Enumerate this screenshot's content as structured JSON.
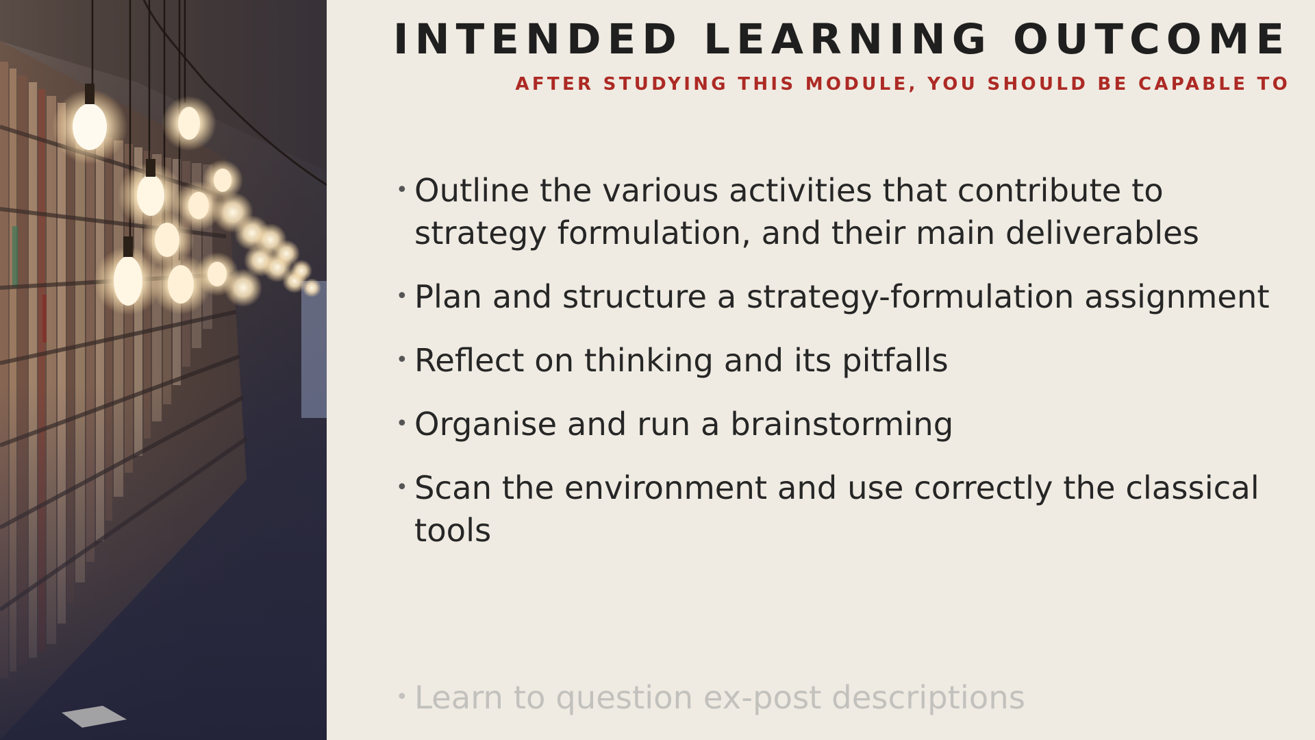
{
  "title": "INTENDED LEARNING OUTCOME",
  "subtitle": "AFTER STUDYING THIS MODULE, YOU SHOULD BE CAPABLE TO",
  "bullet_glyph": "•",
  "outcomes": [
    "Outline the various activities that contribute to strategy formulation, and their main deliverables",
    "Plan and structure a strategy-formulation assignment",
    "Reflect on thinking and its pitfalls",
    "Organise and run a brainstorming",
    "Scan the environment and use correctly the classical tools"
  ],
  "faded_outcome": "Learn to question ex-post descriptions",
  "colors": {
    "background": "#efebe2",
    "title": "#1f1f1f",
    "subtitle": "#ad2a25",
    "body_text": "#262626",
    "faded_text": "#c3c1bd"
  },
  "image": {
    "description_icon": "library-photo"
  }
}
